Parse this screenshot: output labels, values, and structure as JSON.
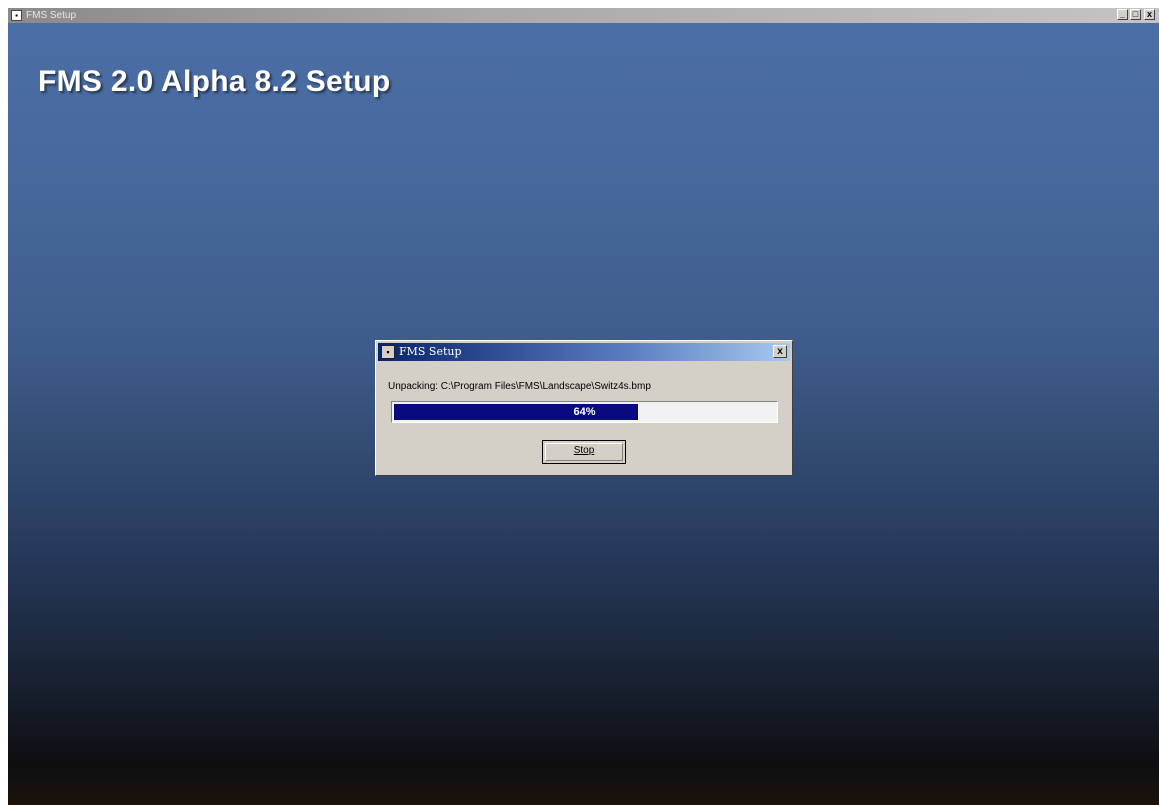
{
  "outer_window": {
    "title": "FMS Setup",
    "controls": {
      "minimize": "_",
      "maximize": "□",
      "close": "x"
    }
  },
  "setup_heading": "FMS 2.0 Alpha 8.2 Setup",
  "dialog": {
    "title": "FMS Setup",
    "close": "x",
    "status_text": "Unpacking: C:\\Program Files\\FMS\\Landscape\\Switz4s.bmp",
    "progress": {
      "percent": 64,
      "label": "64%"
    },
    "stop_button": "Stop"
  },
  "colors": {
    "progress_fill": "#0a0a80",
    "dialog_titlebar": "#0a246a",
    "dialog_face": "#d4d0c8"
  }
}
